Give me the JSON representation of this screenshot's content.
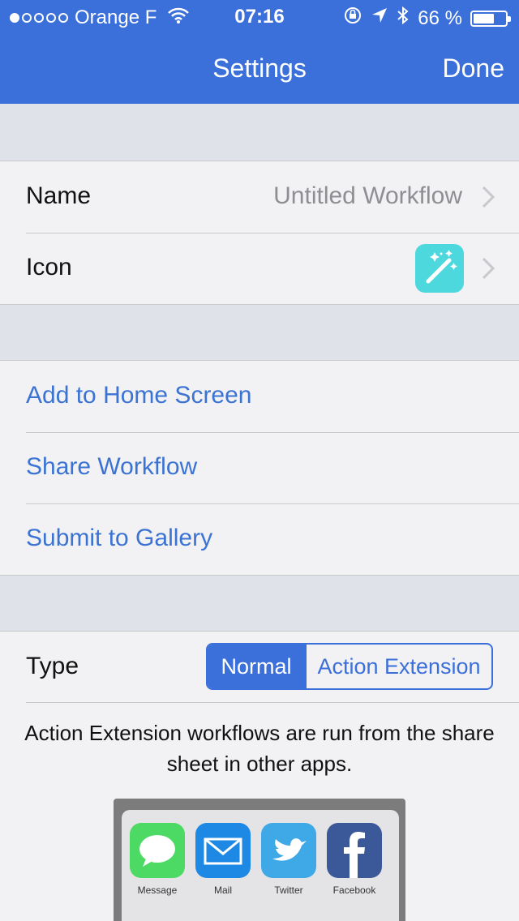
{
  "status_bar": {
    "carrier": "Orange F",
    "time": "07:16",
    "battery_percent": "66 %",
    "battery_level": 0.66
  },
  "nav": {
    "title": "Settings",
    "done_label": "Done"
  },
  "general": {
    "name_label": "Name",
    "name_value": "Untitled Workflow",
    "icon_label": "Icon"
  },
  "actions": {
    "add_home": "Add to Home Screen",
    "share": "Share Workflow",
    "submit": "Submit to Gallery"
  },
  "type": {
    "label": "Type",
    "options": [
      "Normal",
      "Action Extension"
    ],
    "selected": "Normal",
    "description": "Action Extension workflows are run from the share sheet in other apps."
  },
  "share_sheet": {
    "apps": [
      "Message",
      "Mail",
      "Twitter",
      "Facebook"
    ]
  },
  "colors": {
    "accent": "#3b6fd9",
    "link": "#3b73d3",
    "icon_bg": "#4dd8de",
    "message": "#4cd964",
    "mail": "#1e88e5",
    "twitter": "#3fa9e8",
    "facebook": "#3b5998"
  }
}
